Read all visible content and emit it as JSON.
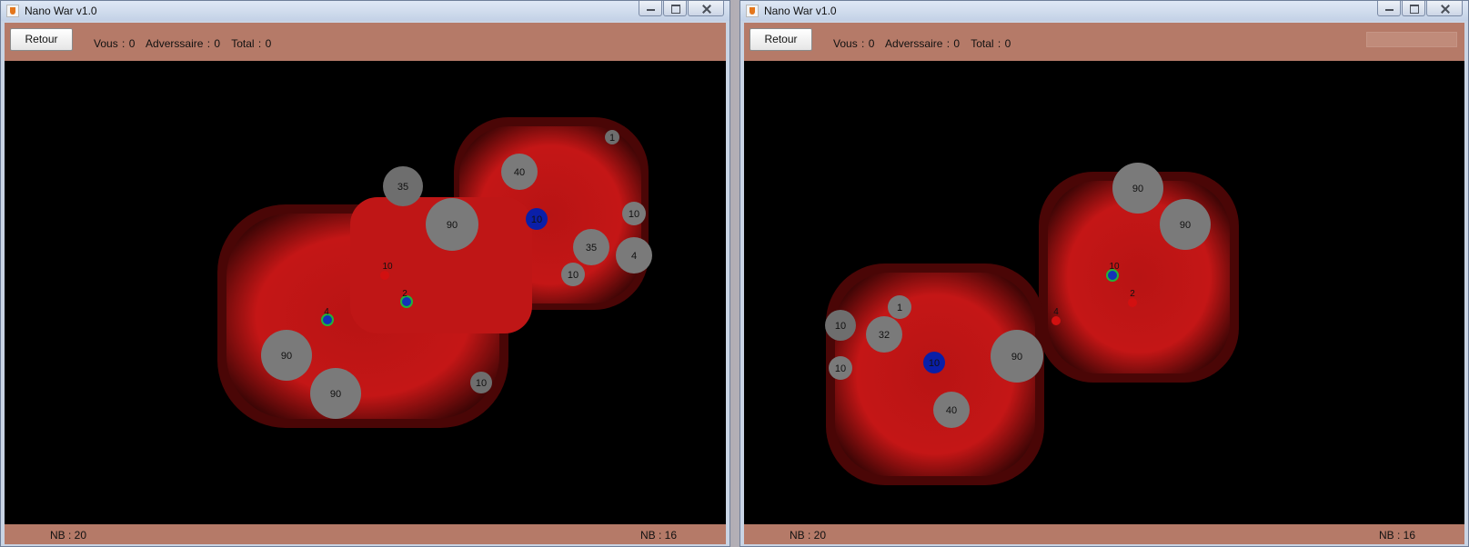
{
  "colors": {
    "panel": "#b57a68",
    "field": "#000000",
    "zone": "#c81818",
    "cell": "#7a7a7a",
    "player_cell": "#0a1fa8",
    "enemy_unit": "#d21010",
    "ally_ring": "#22b43a"
  },
  "windows": [
    {
      "title": "Nano War v1.0",
      "retour_label": "Retour",
      "score_vous": "Vous : 0",
      "score_adversaire": "Adverssaire : 0",
      "score_total": "Total : 0",
      "nb_left": "NB : 20",
      "nb_right": "NB : 16",
      "cells": [
        {
          "label": "40",
          "type": "neutral"
        },
        {
          "label": "90",
          "type": "neutral"
        },
        {
          "label": "10",
          "type": "player"
        },
        {
          "label": "35",
          "type": "neutral"
        },
        {
          "label": "10",
          "type": "neutral"
        },
        {
          "label": "10",
          "type": "neutral"
        },
        {
          "label": "4",
          "type": "neutral"
        },
        {
          "label": "90",
          "type": "neutral"
        },
        {
          "label": "90",
          "type": "neutral"
        },
        {
          "label": "35",
          "type": "neutral"
        },
        {
          "label": "1",
          "type": "neutral"
        },
        {
          "label": "10",
          "type": "neutral"
        }
      ],
      "units": [
        {
          "label": "10",
          "type": "enemy"
        },
        {
          "label": "2",
          "type": "ally"
        },
        {
          "label": "4",
          "type": "ally"
        }
      ]
    },
    {
      "title": "Nano War v1.0",
      "retour_label": "Retour",
      "score_vous": "Vous : 0",
      "score_adversaire": "Adverssaire : 0",
      "score_total": "Total : 0",
      "nb_left": "NB : 20",
      "nb_right": "NB : 16",
      "cells": [
        {
          "label": "90",
          "type": "neutral"
        },
        {
          "label": "90",
          "type": "neutral"
        },
        {
          "label": "1",
          "type": "neutral"
        },
        {
          "label": "32",
          "type": "neutral"
        },
        {
          "label": "10",
          "type": "neutral"
        },
        {
          "label": "10",
          "type": "neutral"
        },
        {
          "label": "10",
          "type": "player"
        },
        {
          "label": "90",
          "type": "neutral"
        },
        {
          "label": "40",
          "type": "neutral"
        }
      ],
      "units": [
        {
          "label": "10",
          "type": "ally"
        },
        {
          "label": "2",
          "type": "enemy"
        },
        {
          "label": "4",
          "type": "enemy"
        }
      ]
    }
  ]
}
